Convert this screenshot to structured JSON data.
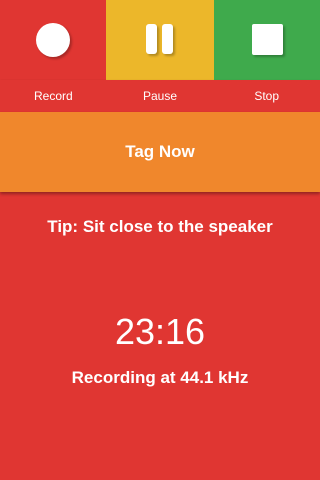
{
  "controls": {
    "record_label": "Record",
    "pause_label": "Pause",
    "stop_label": "Stop",
    "record_color": "#e03632",
    "pause_color": "#ecb72a",
    "stop_color": "#3faa4c",
    "record_icon": "record-circle-icon",
    "pause_icon": "pause-icon",
    "stop_icon": "stop-square-icon"
  },
  "tag_button": {
    "label": "Tag Now",
    "color": "#f0872c"
  },
  "tip": "Tip: Sit close to the speaker",
  "timer": "23:16",
  "status": "Recording at 44.1 kHz",
  "background_color": "#e03632"
}
